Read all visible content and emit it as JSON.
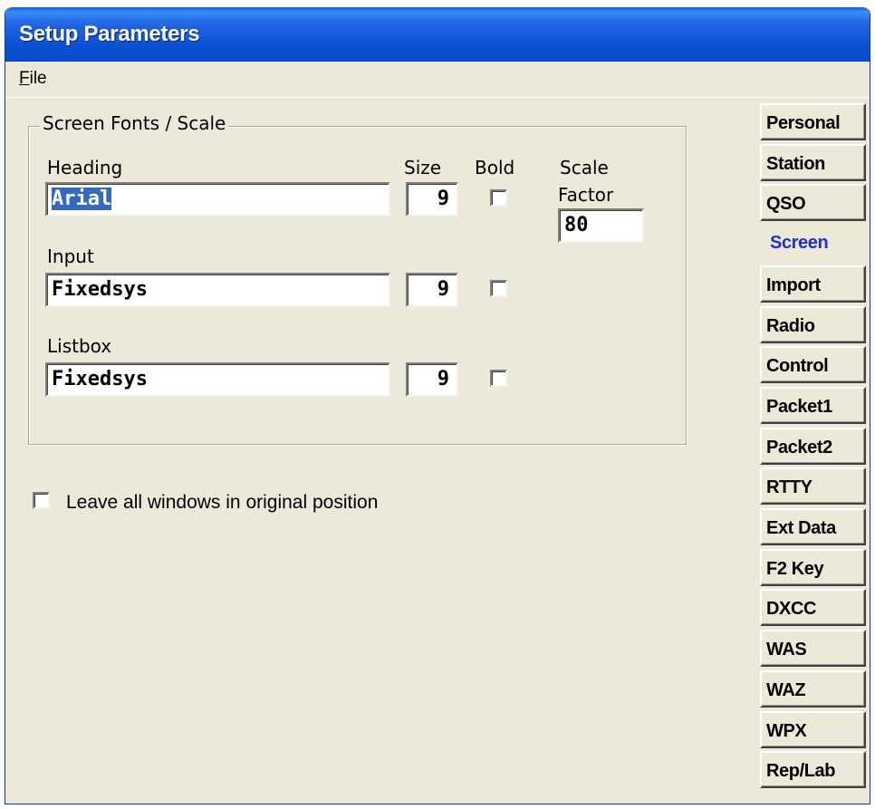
{
  "window": {
    "title": "Setup Parameters"
  },
  "menu": {
    "file_first": "F",
    "file_rest": "ile"
  },
  "group": {
    "legend": "Screen Fonts / Scale",
    "headers": {
      "heading": "Heading",
      "size": "Size",
      "bold": "Bold",
      "scale": "Scale",
      "factor": "Factor"
    },
    "rows": [
      {
        "label": "Heading",
        "font": "Arial",
        "size": "9",
        "bold": false,
        "selected": true
      },
      {
        "label": "Input",
        "font": "Fixedsys",
        "size": "9",
        "bold": false
      },
      {
        "label": "Listbox",
        "font": "Fixedsys",
        "size": "9",
        "bold": false
      }
    ],
    "scale_factor": "80"
  },
  "option": {
    "label": "Leave all windows in original position",
    "checked": false
  },
  "tabs": [
    {
      "label": "Personal"
    },
    {
      "label": "Station"
    },
    {
      "label": "QSO"
    },
    {
      "label": "Screen",
      "active": true
    },
    {
      "label": "Import"
    },
    {
      "label": "Radio"
    },
    {
      "label": "Control"
    },
    {
      "label": "Packet1"
    },
    {
      "label": "Packet2"
    },
    {
      "label": "RTTY"
    },
    {
      "label": "Ext Data"
    },
    {
      "label": "F2 Key"
    },
    {
      "label": "DXCC"
    },
    {
      "label": "WAS"
    },
    {
      "label": "WAZ"
    },
    {
      "label": "WPX"
    },
    {
      "label": "Rep/Lab"
    }
  ],
  "colors": {
    "title_bar": "#0b51d6",
    "dialog_bg": "#ece9d8",
    "active_tab_text": "#1f2fd8",
    "selection": "#316ac5"
  }
}
